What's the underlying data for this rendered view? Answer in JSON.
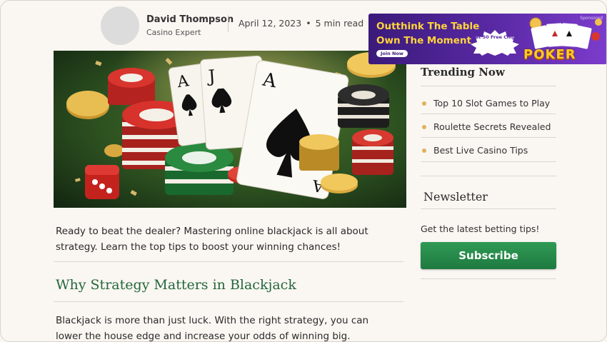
{
  "author": {
    "name": "David Thompson",
    "role": "Casino Expert",
    "date": "April 12, 2023",
    "read_time": "5 min read",
    "separator": "•"
  },
  "article": {
    "intro": "Ready to beat the dealer? Mastering online blackjack is all about strategy. Learn the top tips to boost your winning chances!",
    "heading": "Why Strategy Matters in Blackjack",
    "body": "Blackjack is more than just luck. With the right strategy, you can lower the house edge and increase your odds of winning big."
  },
  "sidebar": {
    "trending_title": "Trending Now",
    "trending_items": [
      {
        "label": "Top 10 Slot Games to Play"
      },
      {
        "label": "Roulette Secrets Revealed"
      },
      {
        "label": "Best Live Casino Tips"
      }
    ],
    "newsletter_title": "Newsletter",
    "newsletter_text": "Get the latest betting tips!",
    "subscribe_label": "Subscribe"
  },
  "ad": {
    "sponsored": "Sponsored",
    "headline_1": "Outthink The Table",
    "headline_2": "Own The Moment",
    "offer": "Get 50 Free Chips",
    "cta": "Join Now",
    "logo": "POKER"
  },
  "hero_card_ranks": [
    "A",
    "J",
    "A",
    "A"
  ],
  "colors": {
    "accent_green": "#23673a",
    "button_green": "#1f7a40",
    "bullet": "#e0b25a",
    "ad_purple": "#5b2aa6",
    "ad_yellow": "#ffd43b"
  }
}
